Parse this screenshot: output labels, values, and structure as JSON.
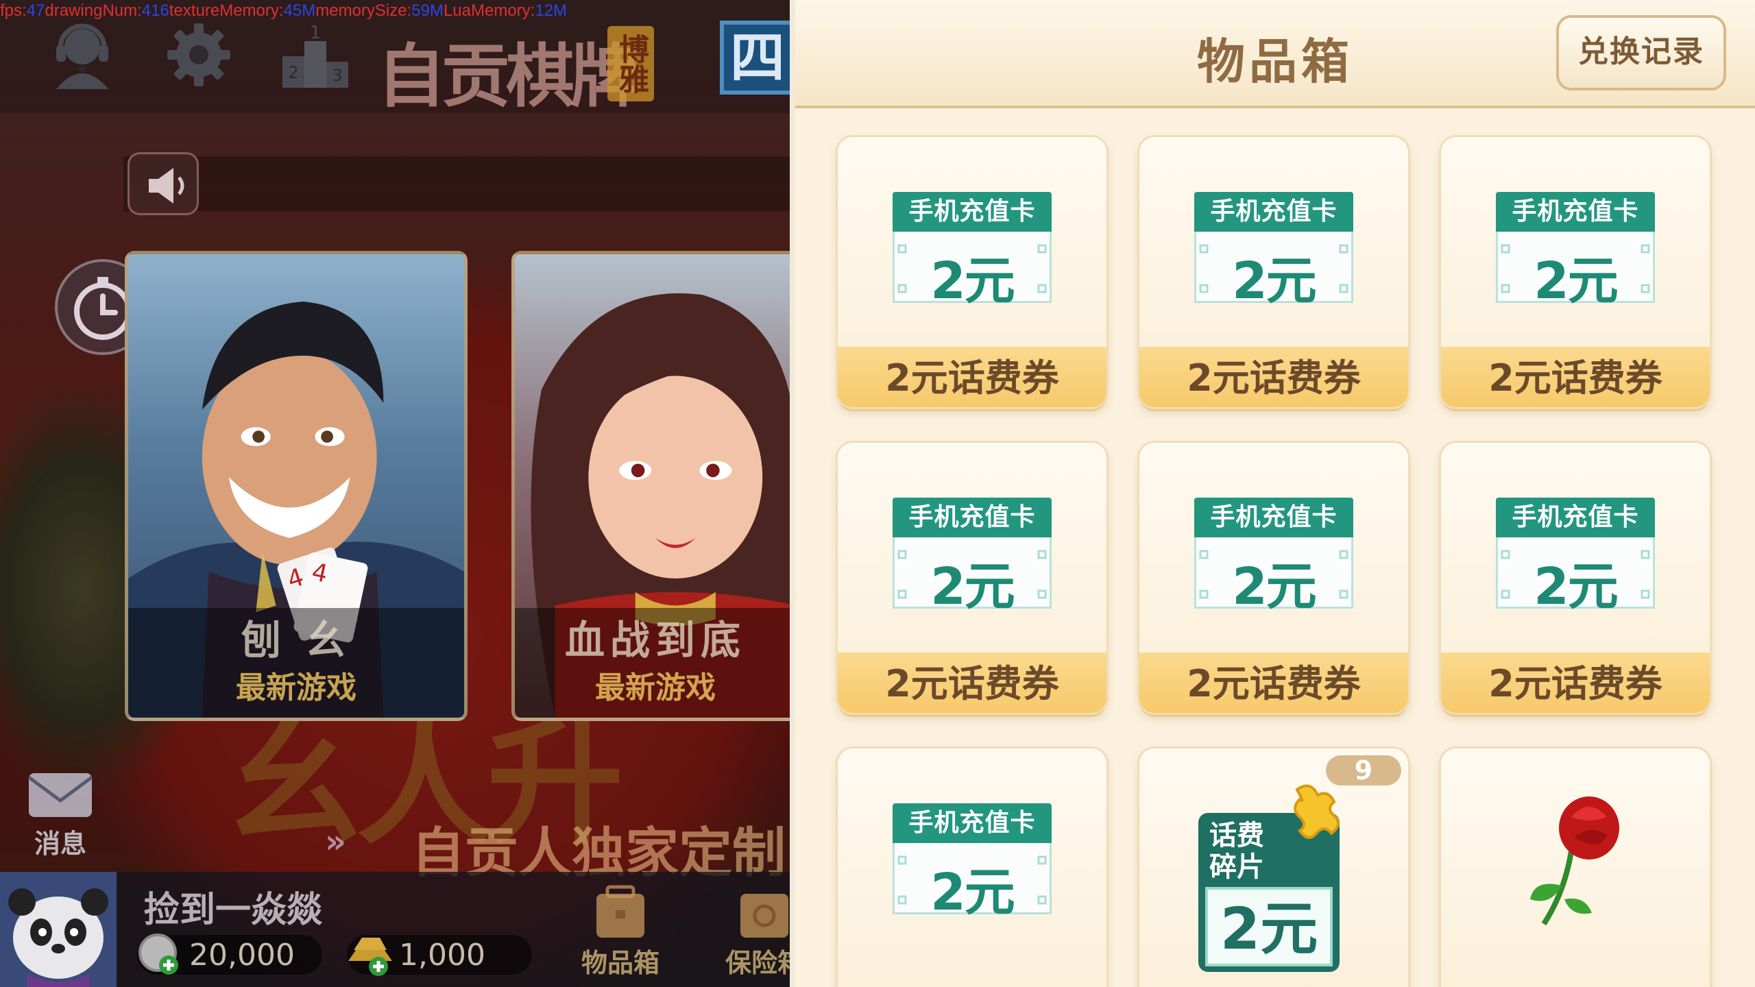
{
  "debug": {
    "fps_key": "fps:",
    "fps": "47",
    "draw_key": "drawingNum:",
    "draw": "416",
    "tex_key": "textureMemory:",
    "tex": "45M",
    "mem_key": "memorySize:",
    "mem": "59M",
    "lua_key": "LuaMemory:",
    "lua": "12M"
  },
  "lobby": {
    "brand": "自贡棋牌",
    "brand_seal": "博雅",
    "extra_badge": "四",
    "games": [
      {
        "name": "刨 幺",
        "tag": "最新游戏"
      },
      {
        "name": "血战到底",
        "tag": "最新游戏"
      }
    ],
    "message_label": "消息",
    "more_arrows": "»",
    "promo": "自贡人独家定制.",
    "bg_calligraphy": "幺人升",
    "player_name": "捡到一焱燚",
    "coins": "20,000",
    "gold": "1,000",
    "inventory_label": "物品箱",
    "safe_label": "保险箱"
  },
  "panel": {
    "title": "物品箱",
    "exchange_label": "兑换记录",
    "items": [
      {
        "card_head": "手机充值卡",
        "card_value": "2元",
        "name": "2元话费券"
      },
      {
        "card_head": "手机充值卡",
        "card_value": "2元",
        "name": "2元话费券"
      },
      {
        "card_head": "手机充值卡",
        "card_value": "2元",
        "name": "2元话费券"
      },
      {
        "card_head": "手机充值卡",
        "card_value": "2元",
        "name": "2元话费券"
      },
      {
        "card_head": "手机充值卡",
        "card_value": "2元",
        "name": "2元话费券"
      },
      {
        "card_head": "手机充值卡",
        "card_value": "2元",
        "name": "2元话费券"
      },
      {
        "card_head": "手机充值卡",
        "card_value": "2元",
        "name": ""
      }
    ],
    "fragment": {
      "top": "话费",
      "bottom": "碎片",
      "value": "2元",
      "count": "9"
    },
    "colors": {
      "accent_green": "#239680",
      "band_gold": "#f7c96b",
      "title_brown": "#8e6b43"
    }
  }
}
